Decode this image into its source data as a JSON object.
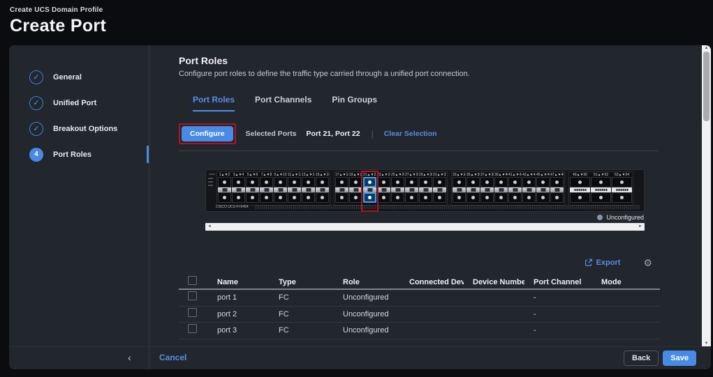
{
  "colors": {
    "accent": "#5b8ce8",
    "button_blue": "#478be6",
    "annotation_red": "#b01320",
    "selected_port_border": "#41a2ea",
    "unconfigured_dot": "#8a93a8"
  },
  "icons": {
    "gear": "⚙",
    "check": "✓",
    "scroll_up": "▲",
    "scroll_down": "▼",
    "scroll_left": "◄",
    "scroll_right": "►"
  },
  "header": {
    "breadcrumb": "Create UCS Domain Profile",
    "title": "Create Port"
  },
  "steps": [
    {
      "label": "General",
      "state": "complete"
    },
    {
      "label": "Unified Port",
      "state": "complete"
    },
    {
      "label": "Breakout Options",
      "state": "complete"
    },
    {
      "label": "Port Roles",
      "state": "active",
      "number": "4"
    }
  ],
  "section": {
    "title": "Port Roles",
    "description": "Configure port roles to define the traffic type carried through a unified port connection."
  },
  "tabs": [
    {
      "label": "Port Roles",
      "active": true
    },
    {
      "label": "Port Channels",
      "active": false
    },
    {
      "label": "Pin Groups",
      "active": false
    }
  ],
  "toolbar": {
    "configure_label": "Configure",
    "selected_ports_label": "Selected Ports",
    "selected_ports_value": "Port 21, Port 22",
    "clear_selection_label": "Clear Selection"
  },
  "device": {
    "model": "CISCO UCS-FI-6454",
    "legend": "Unconfigured",
    "selected_pair": [
      21,
      22
    ],
    "port_groups": [
      {
        "type": "sfp",
        "pairs": [
          [
            1,
            2
          ],
          [
            3,
            4
          ],
          [
            5,
            6
          ],
          [
            7,
            8
          ],
          [
            9,
            10
          ],
          [
            11,
            12
          ],
          [
            13,
            14
          ],
          [
            15,
            16
          ]
        ]
      },
      {
        "type": "sfp",
        "pairs": [
          [
            17,
            18
          ],
          [
            19,
            20
          ],
          [
            21,
            22
          ],
          [
            23,
            24
          ],
          [
            25,
            26
          ],
          [
            27,
            28
          ],
          [
            29,
            30
          ],
          [
            31,
            32
          ]
        ]
      },
      {
        "type": "sfp",
        "pairs": [
          [
            33,
            34
          ],
          [
            35,
            36
          ],
          [
            37,
            38
          ],
          [
            39,
            40
          ],
          [
            41,
            42
          ],
          [
            43,
            44
          ],
          [
            45,
            46
          ],
          [
            47,
            48
          ]
        ]
      },
      {
        "type": "qsfp",
        "pairs": [
          [
            49,
            50
          ],
          [
            51,
            52
          ],
          [
            53,
            54
          ]
        ]
      }
    ]
  },
  "table": {
    "export_label": "Export",
    "headers": [
      "Name",
      "Type",
      "Role",
      "Connected Devic...",
      "Device Number",
      "Port Channel",
      "Mode"
    ],
    "rows": [
      {
        "name": "port 1",
        "type": "FC",
        "role": "Unconfigured",
        "connected_device": "",
        "device_number": "",
        "port_channel": "-",
        "mode": ""
      },
      {
        "name": "port 2",
        "type": "FC",
        "role": "Unconfigured",
        "connected_device": "",
        "device_number": "",
        "port_channel": "-",
        "mode": ""
      },
      {
        "name": "port 3",
        "type": "FC",
        "role": "Unconfigured",
        "connected_device": "",
        "device_number": "",
        "port_channel": "-",
        "mode": ""
      }
    ]
  },
  "footer": {
    "cancel_label": "Cancel",
    "back_label": "Back",
    "save_label": "Save",
    "collapse_label": "‹"
  }
}
